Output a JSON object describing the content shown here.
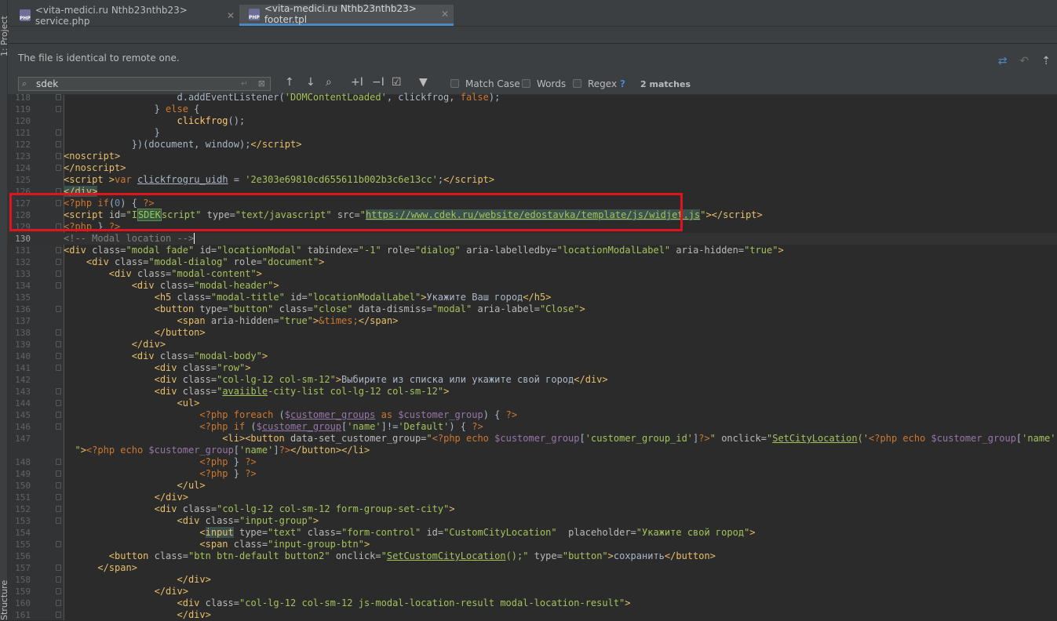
{
  "left_strip": {
    "project_label": "1: Project",
    "structure_label": "Structure"
  },
  "tabs": [
    {
      "label": "<vita-medici.ru Nthb23nthb23> service.php",
      "active": false,
      "icon": "php-file-icon"
    },
    {
      "label": "<vita-medici.ru Nthb23nthb23> footer.tpl",
      "active": true,
      "icon": "php-file-icon"
    }
  ],
  "notification": {
    "message": "The file is identical to remote one."
  },
  "search": {
    "query": "sdek",
    "match_case_label": "Match Case",
    "words_label": "Words",
    "regex_label": "Regex",
    "help_label": "?",
    "matches_label": "2 matches",
    "match_case_checked": false,
    "words_checked": false,
    "regex_checked": false
  },
  "editor": {
    "line_numbers": [
      "118",
      "119",
      "120",
      "121",
      "122",
      "123",
      "124",
      "125",
      "126",
      "127",
      "128",
      "129",
      "130",
      "131",
      "132",
      "133",
      "134",
      "135",
      "136",
      "137",
      "138",
      "139",
      "140",
      "141",
      "142",
      "143",
      "144",
      "145",
      "146",
      "147",
      "",
      "148",
      "149",
      "150",
      "151",
      "152",
      "153",
      "154",
      "155",
      "156",
      "157",
      "158",
      "159",
      "160",
      "161"
    ],
    "caret_line": "130"
  },
  "colors": {
    "tag": "#e8bf6a",
    "attr_value": "#a5c25c",
    "keyword": "#cc7832",
    "variable": "#9876aa",
    "comment": "#808080",
    "highlight_box": "#e0141c",
    "tab_underline": "#4a88c7"
  }
}
